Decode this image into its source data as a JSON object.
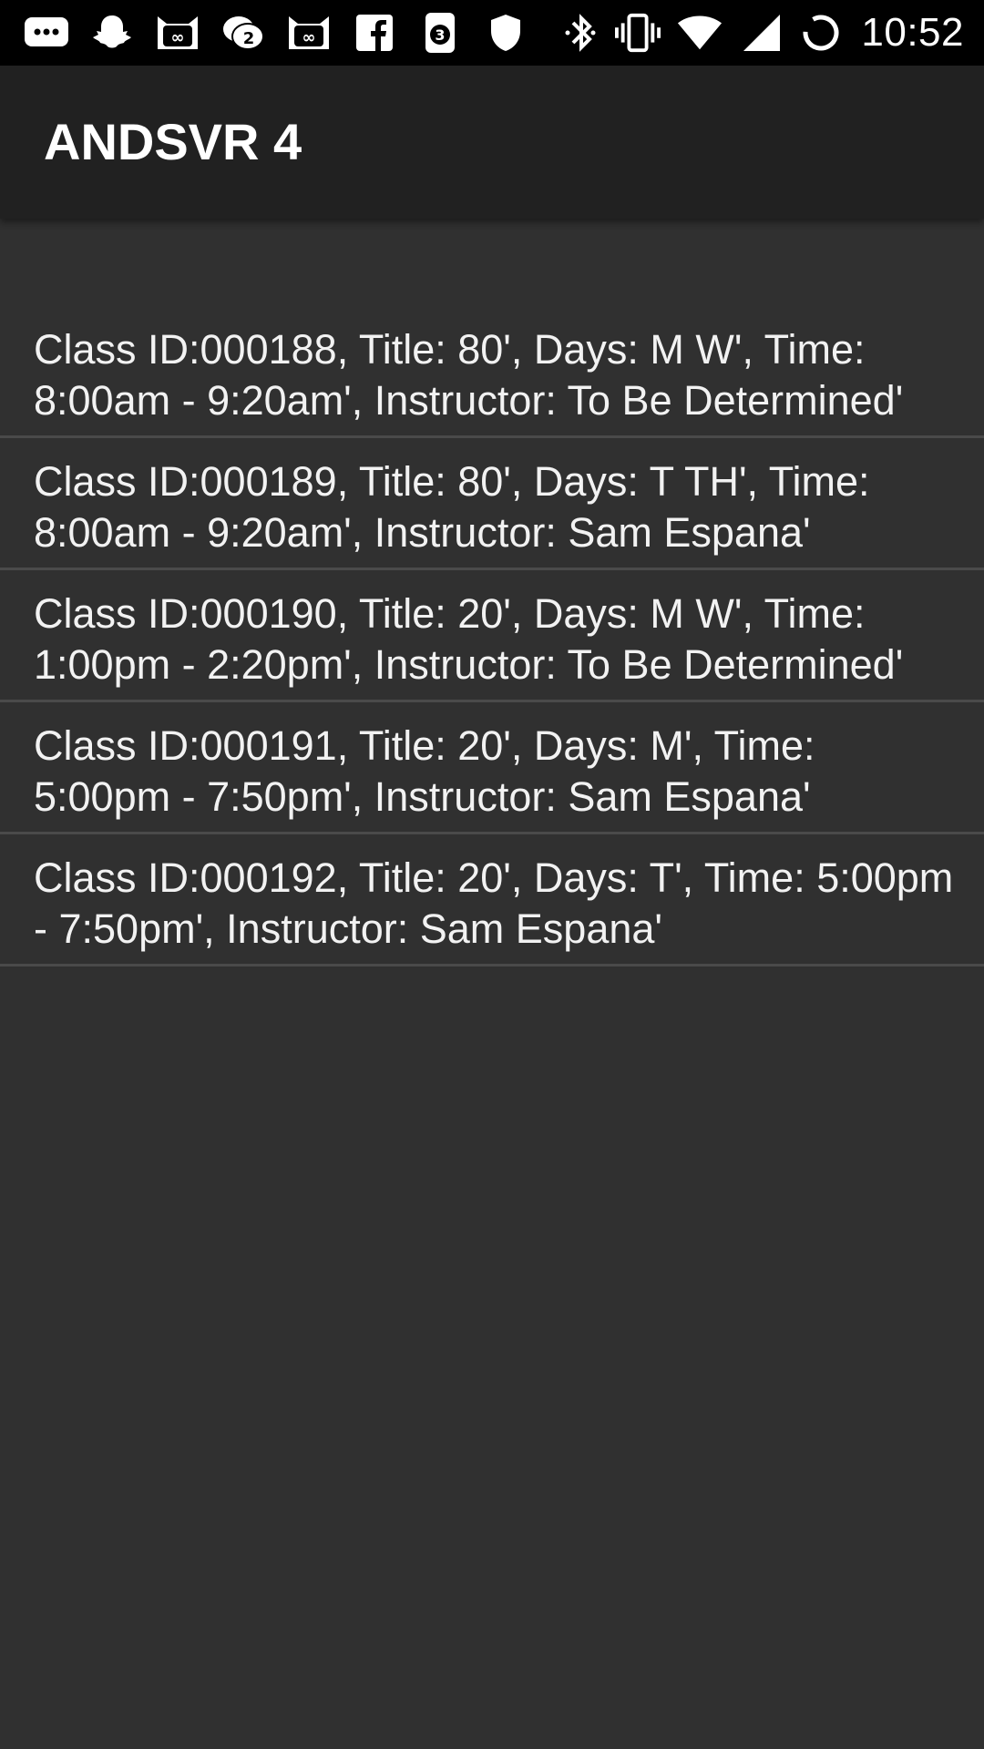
{
  "status_bar": {
    "time": "10:52",
    "left_icons": [
      {
        "name": "messages-icon"
      },
      {
        "name": "snapchat-icon"
      },
      {
        "name": "cat-app-icon",
        "badge": "∞"
      },
      {
        "name": "chat-bubbles-icon",
        "badge": "2"
      },
      {
        "name": "cat-app-icon",
        "badge": "∞"
      },
      {
        "name": "facebook-icon"
      },
      {
        "name": "phone-notification-icon",
        "badge": "3"
      },
      {
        "name": "shield-icon"
      }
    ],
    "right_icons": [
      "bluetooth-icon",
      "vibrate-icon",
      "wifi-icon",
      "cell-signal-icon",
      "loading-spinner-icon"
    ]
  },
  "app_bar": {
    "title": "ANDSVR 4"
  },
  "classes": [
    {
      "text": "Class ID:000188, Title: 80', Days: M W', Time: 8:00am - 9:20am', Instructor: To Be Determined'"
    },
    {
      "text": "Class ID:000189, Title: 80', Days: T TH', Time: 8:00am - 9:20am', Instructor: Sam Espana'"
    },
    {
      "text": "Class ID:000190, Title: 20', Days: M W', Time: 1:00pm - 2:20pm', Instructor: To Be Determined'"
    },
    {
      "text": "Class ID:000191, Title: 20', Days: M', Time: 5:00pm - 7:50pm', Instructor: Sam Espana'"
    },
    {
      "text": "Class ID:000192, Title: 20', Days: T', Time: 5:00pm - 7:50pm', Instructor: Sam Espana'"
    }
  ],
  "colors": {
    "background": "#303030",
    "app_bar": "#212121",
    "status_bar": "#000000",
    "divider": "#4a4a4a",
    "text": "#f2f2f2"
  }
}
